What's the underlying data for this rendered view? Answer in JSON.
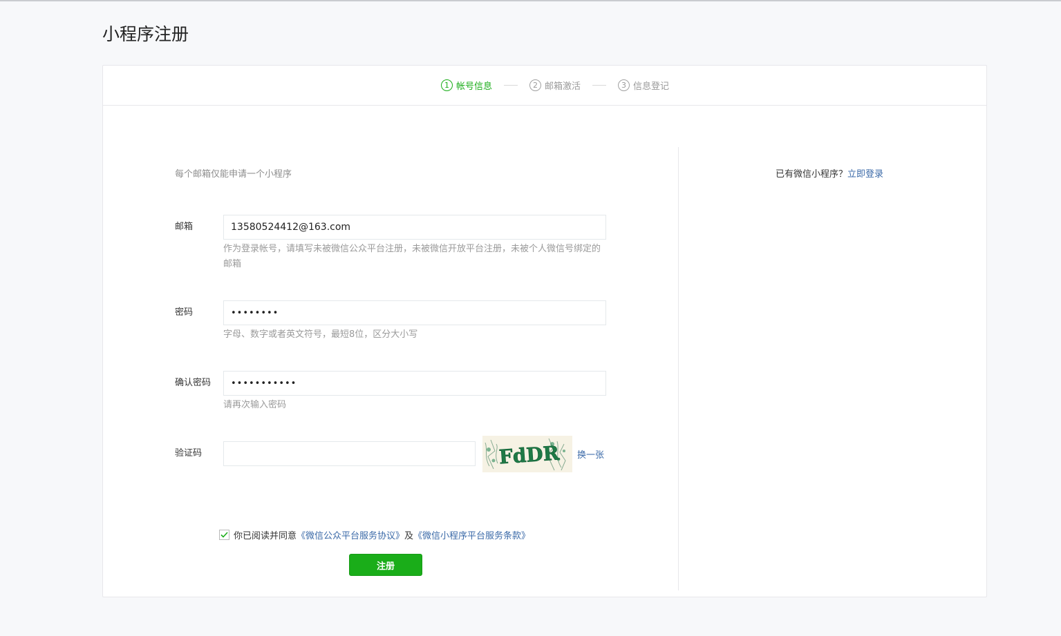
{
  "page": {
    "title": "小程序注册"
  },
  "steps": [
    {
      "num": "1",
      "label": "帐号信息"
    },
    {
      "num": "2",
      "label": "邮箱激活"
    },
    {
      "num": "3",
      "label": "信息登记"
    }
  ],
  "form": {
    "tip": "每个邮箱仅能申请一个小程序",
    "email": {
      "label": "邮箱",
      "value": "13580524412@163.com",
      "hint": "作为登录帐号，请填写未被微信公众平台注册，未被微信开放平台注册，未被个人微信号绑定的邮箱"
    },
    "password": {
      "label": "密码",
      "value": "••••••••",
      "hint": "字母、数字或者英文符号，最短8位，区分大小写"
    },
    "confirm": {
      "label": "确认密码",
      "value": "•••••••••••",
      "hint": "请再次输入密码"
    },
    "captcha": {
      "label": "验证码",
      "value": "",
      "image_text": "FdDR",
      "refresh": "换一张"
    },
    "agree": {
      "checked": true,
      "text": "你已阅读并同意",
      "link1": "《微信公众平台服务协议》",
      "and": "及",
      "link2": "《微信小程序平台服务条款》"
    },
    "submit": "注册"
  },
  "side": {
    "hint": "已有微信小程序？",
    "link": "立即登录"
  },
  "colors": {
    "accent": "#1aad19",
    "link": "#3b6aa8"
  }
}
